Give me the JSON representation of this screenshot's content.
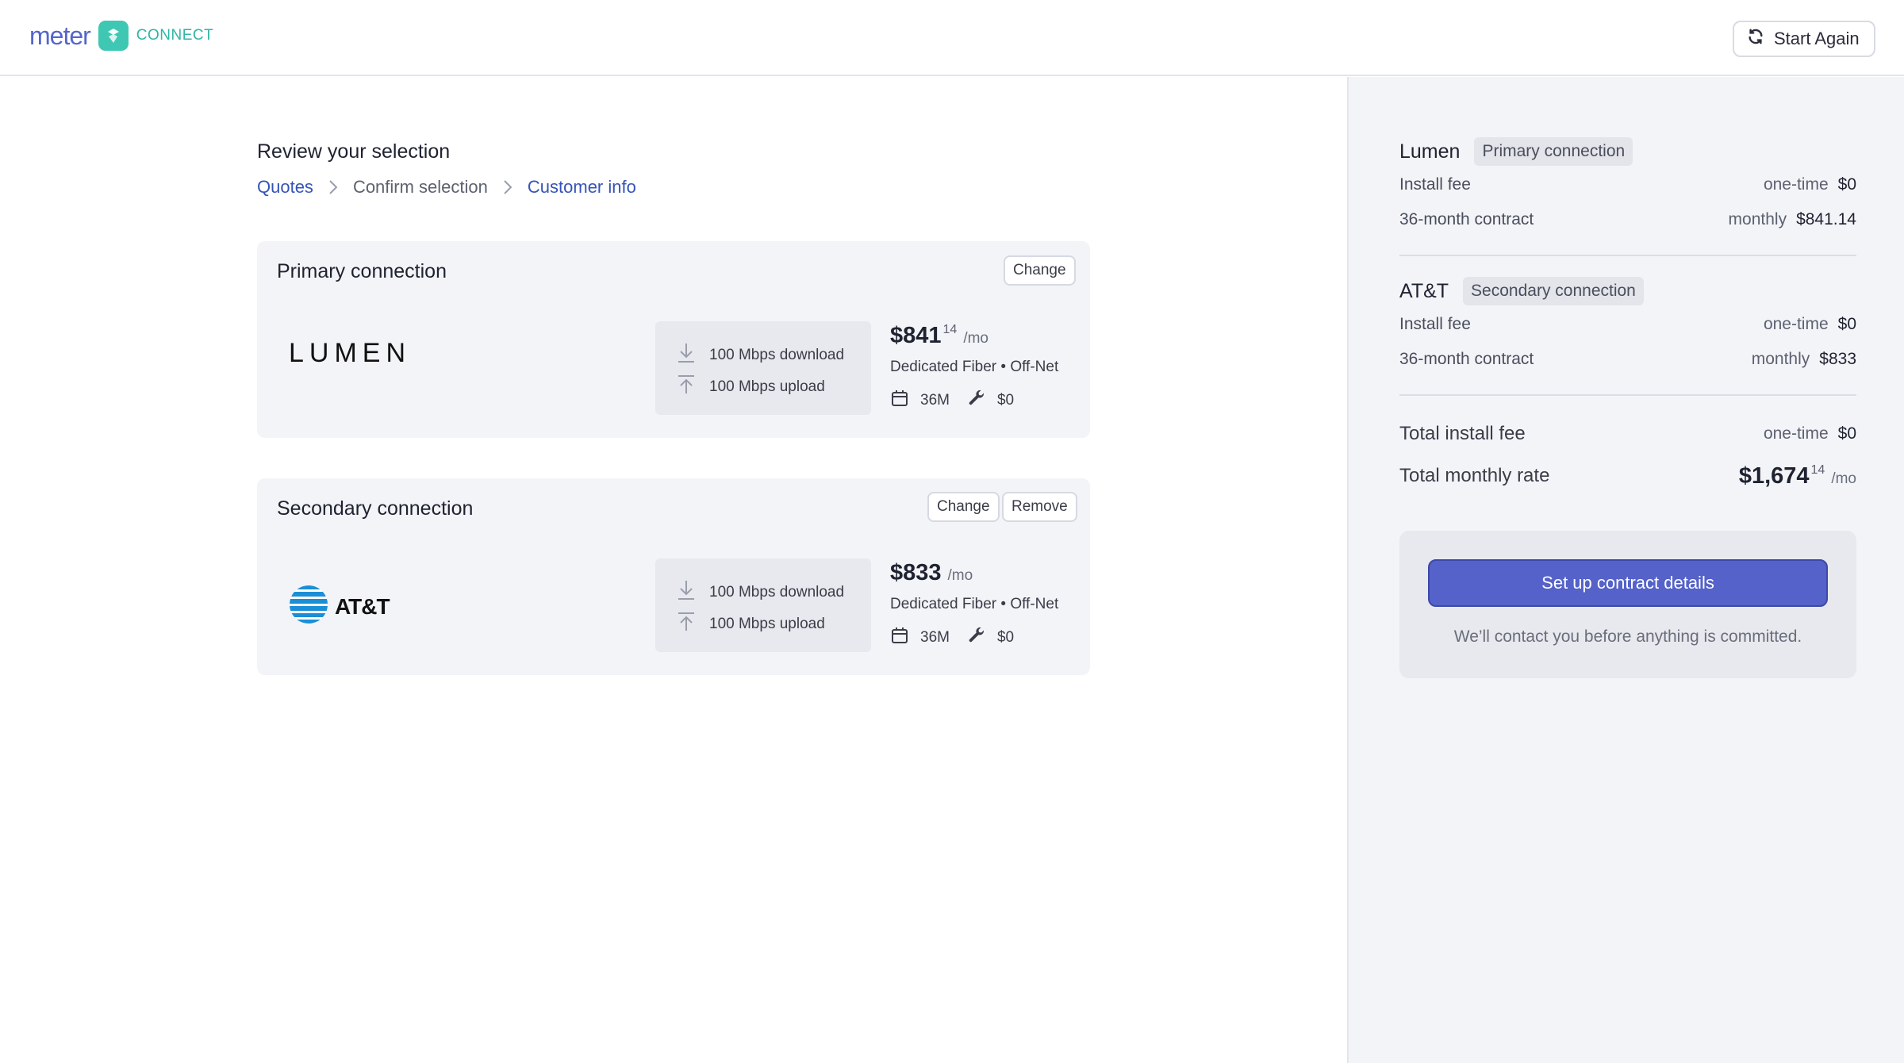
{
  "header": {
    "brand_word": "meter",
    "brand_product": "CONNECT",
    "start_again_label": "Start Again"
  },
  "main": {
    "title": "Review your selection",
    "breadcrumb": [
      "Quotes",
      "Confirm selection",
      "Customer info"
    ]
  },
  "cards": [
    {
      "title": "Primary connection",
      "buttons": [
        "Change"
      ],
      "provider": "LUMEN",
      "download": "100 Mbps download",
      "upload": "100 Mbps upload",
      "price_whole": "$841",
      "price_cents": "14",
      "price_unit": "/mo",
      "type": "Dedicated Fiber • Off-Net",
      "term": "36M",
      "install": "$0"
    },
    {
      "title": "Secondary connection",
      "buttons": [
        "Change",
        "Remove"
      ],
      "provider": "AT&T",
      "download": "100 Mbps download",
      "upload": "100 Mbps upload",
      "price_whole": "$833",
      "price_cents": "",
      "price_unit": "/mo",
      "type": "Dedicated Fiber • Off-Net",
      "term": "36M",
      "install": "$0"
    }
  ],
  "summary": {
    "groups": [
      {
        "provider": "Lumen",
        "tag": "Primary connection",
        "install_label": "Install fee",
        "install_qual": "one-time",
        "install_value": "$0",
        "contract_label": "36-month contract",
        "contract_qual": "monthly",
        "contract_value": "$841.14"
      },
      {
        "provider": "AT&T",
        "tag": "Secondary connection",
        "install_label": "Install fee",
        "install_qual": "one-time",
        "install_value": "$0",
        "contract_label": "36-month contract",
        "contract_qual": "monthly",
        "contract_value": "$833"
      }
    ],
    "total_install_label": "Total install fee",
    "total_install_qual": "one-time",
    "total_install_value": "$0",
    "total_monthly_label": "Total monthly rate",
    "total_monthly_whole": "$1,674",
    "total_monthly_cents": "14",
    "total_monthly_unit": "/mo",
    "cta_label": "Set up contract details",
    "cta_note": "We’ll contact you before anything is committed."
  },
  "colors": {
    "accent": "#5462c9",
    "link": "#3553b8",
    "brand_teal": "#3ec8b4",
    "panel_bg": "#f3f4f8"
  },
  "icons": [
    "refresh-icon",
    "chevron-right-icon",
    "download-arrow-icon",
    "upload-arrow-icon",
    "calendar-icon",
    "wrench-icon",
    "att-globe-icon"
  ]
}
